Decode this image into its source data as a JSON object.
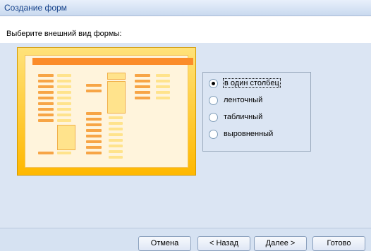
{
  "window": {
    "title": "Создание форм"
  },
  "header": {
    "prompt": "Выберите внешний вид формы:"
  },
  "options": [
    {
      "label": "в один столбец",
      "checked": true
    },
    {
      "label": "ленточный",
      "checked": false
    },
    {
      "label": "табличный",
      "checked": false
    },
    {
      "label": "выровненный",
      "checked": false
    }
  ],
  "buttons": {
    "cancel": "Отмена",
    "back": "< Назад",
    "next": "Далее >",
    "finish": "Готово"
  },
  "colors": {
    "title": "#15428b",
    "preview_frame": "#ffb800",
    "field": "#f7a546"
  }
}
